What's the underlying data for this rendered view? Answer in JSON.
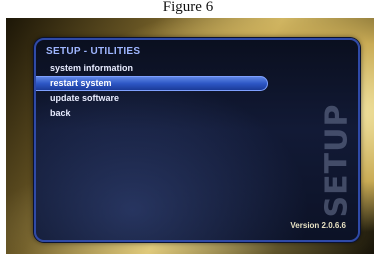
{
  "caption": "Figure 6",
  "screen": {
    "title": "SETUP - UTILITIES",
    "menu": [
      {
        "label": "system information",
        "selected": false
      },
      {
        "label": "restart system",
        "selected": true
      },
      {
        "label": "update software",
        "selected": false
      },
      {
        "label": "back",
        "selected": false
      }
    ],
    "watermark": "SETUP",
    "version": "Version 2.0.6.6"
  },
  "colors": {
    "selection": "#2d57c5",
    "title": "#9fb6ff",
    "frame_gold": "#c9ab55"
  }
}
